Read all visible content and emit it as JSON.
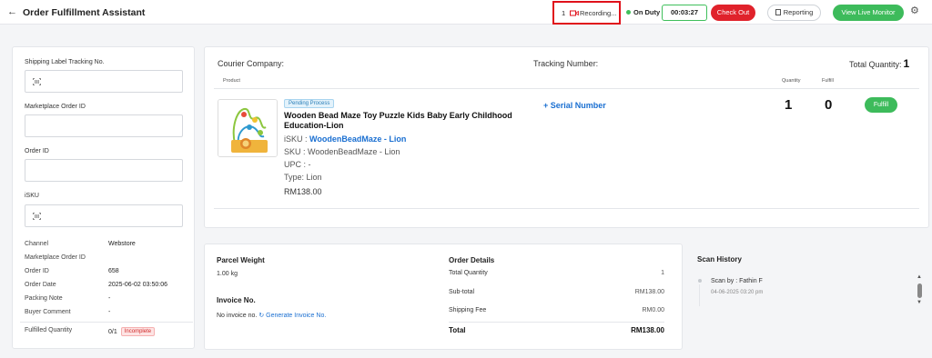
{
  "header": {
    "back_icon": "arrow-left-icon",
    "title": "Order Fulfillment Assistant",
    "recording_count": "1",
    "recording_icon": "video-camera-icon",
    "recording_label": "Recording...",
    "duty_status": "On Duty",
    "timer": "00:03:27",
    "checkout_label": "Check Out",
    "reporting_label": "Reporting",
    "live_monitor_label": "View Live Monitor",
    "settings_icon": "gear-icon",
    "colors": {
      "green": "#3dbb5b",
      "red": "#e0222b",
      "highlight": "#e0111b"
    }
  },
  "left": {
    "shipping_label": "Shipping Label Tracking No.",
    "shipping_value": "",
    "marketplace_label": "Marketplace Order ID",
    "marketplace_value": "",
    "order_id_label": "Order ID",
    "order_id_value": "",
    "isku_label": "iSKU",
    "isku_value": "",
    "info": [
      {
        "key": "Channel",
        "value": "Webstore"
      },
      {
        "key": "Marketplace Order ID",
        "value": ""
      },
      {
        "key": "Order ID",
        "value": "658"
      },
      {
        "key": "Order Date",
        "value": "2025-06-02 03:50:06"
      },
      {
        "key": "Packing Note",
        "value": "-"
      },
      {
        "key": "Buyer Comment",
        "value": "-"
      }
    ],
    "fulfilled_label": "Fulfilled Quantity",
    "fulfilled_value": "0/1",
    "fulfilled_badge": "Incomplete"
  },
  "main": {
    "courier_label": "Courier Company:",
    "tracking_label": "Tracking Number:",
    "total_qty_label": "Total Quantity:",
    "total_qty_value": "1",
    "col_product": "Product",
    "col_quantity": "Quantity",
    "col_fulfill": "Fulfill",
    "item": {
      "status": "Pending Process",
      "name": "Wooden Bead Maze Toy Puzzle Kids Baby Early Childhood Education-Lion",
      "isku_label": "iSKU :",
      "isku_value": "WoodenBeadMaze - Lion",
      "sku": "SKU : WoodenBeadMaze - Lion",
      "upc": "UPC : -",
      "type": "Type: Lion",
      "price": "RM138.00",
      "serial_label": "+ Serial Number",
      "quantity": "1",
      "fulfilled": "0",
      "fulfill_button": "Fulfill"
    }
  },
  "bottom": {
    "parcel_weight_label": "Parcel Weight",
    "parcel_weight_value": "1.00 kg",
    "invoice_label": "Invoice No.",
    "invoice_value": "No invoice no.",
    "generate_label": "Generate Invoice No.",
    "order_details_label": "Order Details",
    "details": [
      {
        "key": "Total Quantity",
        "value": "1"
      },
      {
        "key": "Sub-total",
        "value": "RM138.00"
      },
      {
        "key": "Shipping Fee",
        "value": "RM0.00"
      }
    ],
    "total_label": "Total",
    "total_value": "RM138.00"
  },
  "history": {
    "title": "Scan History",
    "entries": [
      {
        "scan_by": "Scan by : Fathin F",
        "time": "04-06-2025 03:20 pm"
      }
    ]
  }
}
